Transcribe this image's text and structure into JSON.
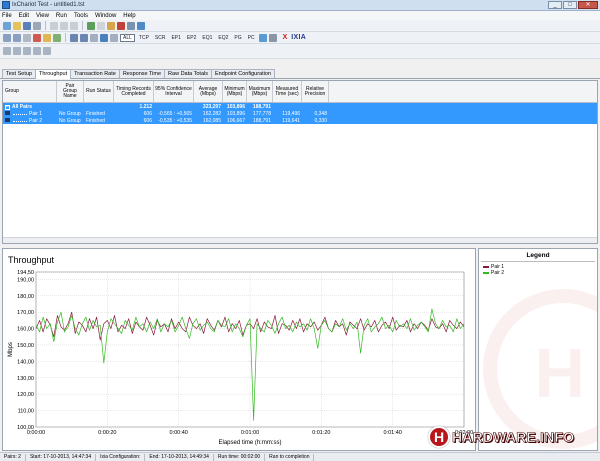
{
  "window": {
    "title": "IxChariot Test - untitled1.tst",
    "minimize": "_",
    "maximize": "□",
    "close": "✕"
  },
  "menu": [
    "File",
    "Edit",
    "View",
    "Run",
    "Tools",
    "Window",
    "Help"
  ],
  "toolbar": {
    "text_buttons": [
      "ALL",
      "TCP",
      "SCR",
      "EP1",
      "EP2",
      "EQ1",
      "EQ2",
      "PG",
      "PC"
    ],
    "brand": "IXIA",
    "brand_mark": "X"
  },
  "tabs": [
    "Test Setup",
    "Throughput",
    "Transaction Rate",
    "Response Time",
    "Raw Data Totals",
    "Endpoint Configuration"
  ],
  "active_tab": "Throughput",
  "grid": {
    "headers": [
      "Group",
      "Pair Group Name",
      "Run Status",
      "Timing Records Completed",
      "95% Confidence Interval",
      "Average (Mbps)",
      "Minimum (Mbps)",
      "Maximum (Mbps)",
      "Measured Time (sec)",
      "Relative Precision"
    ],
    "all_pairs": {
      "expander": "−",
      "label": "All Pairs",
      "records": "1.212",
      "average": "323,297",
      "minimum": "103,896",
      "maximum": "188,791"
    },
    "rows": [
      {
        "group": "Pair 1",
        "pair_group_name": "No Group",
        "run_status": "Finished",
        "records": "606",
        "ci": "-0,565 : +0,565",
        "average": "162,282",
        "minimum": "103,896",
        "maximum": "177,778",
        "measured_time": "119,496",
        "precision": "0,348"
      },
      {
        "group": "Pair 2",
        "pair_group_name": "No Group",
        "run_status": "Finished",
        "records": "606",
        "ci": "-0,535 : +0,535",
        "average": "162,085",
        "minimum": "106,667",
        "maximum": "188,791",
        "measured_time": "119,641",
        "precision": "0,330"
      }
    ]
  },
  "chart": {
    "title": "Throughput",
    "legend_title": "Legend"
  },
  "chart_data": {
    "type": "line",
    "title": "Throughput",
    "xlabel": "Elapsed time (h:mm:ss)",
    "ylabel": "Mbps",
    "xlim": [
      0,
      120
    ],
    "ylim": [
      100,
      194.5
    ],
    "x_ticks": [
      "0:00:00",
      "0:00:20",
      "0:00:40",
      "0:01:00",
      "0:01:20",
      "0:01:40",
      "0:02:00"
    ],
    "y_ticks": [
      "194,50",
      "190,00",
      "180,00",
      "170,00",
      "160,00",
      "150,00",
      "140,00",
      "130,00",
      "120,00",
      "110,00",
      "100,00"
    ],
    "grid": true,
    "legend_position": "side panel",
    "series": [
      {
        "name": "Pair 1",
        "color": "#8b1a3a",
        "values": [
          160,
          165,
          158,
          166,
          162,
          155,
          168,
          161,
          159,
          163,
          170,
          157,
          164,
          162,
          158,
          166,
          160,
          167,
          153,
          163,
          165,
          160,
          168,
          158,
          162,
          160,
          166,
          157,
          164,
          161,
          159,
          167,
          162,
          156,
          165,
          161,
          163,
          158,
          166,
          160,
          164,
          160,
          158,
          167,
          162,
          160,
          163,
          157,
          166,
          162,
          159,
          165,
          161,
          167,
          158,
          163,
          160,
          165,
          156,
          162,
          163,
          160,
          166,
          158,
          164,
          161,
          160,
          168,
          157,
          163,
          162,
          159,
          165,
          160,
          166,
          158,
          163,
          161,
          164,
          159,
          162,
          167,
          160,
          158,
          165,
          161,
          163,
          156,
          164,
          162,
          160,
          166,
          159,
          163,
          161,
          165,
          158,
          162,
          164,
          160,
          167,
          159,
          162,
          161,
          165,
          158,
          163,
          160,
          164,
          162,
          159,
          166,
          161,
          160,
          163,
          158,
          165,
          162,
          160,
          164,
          161
        ]
      },
      {
        "name": "Pair 2",
        "color": "#33bb22",
        "values": [
          162,
          158,
          167,
          160,
          163,
          152,
          164,
          170,
          158,
          161,
          168,
          160,
          156,
          163,
          167,
          159,
          165,
          161,
          162,
          139,
          158,
          166,
          163,
          160,
          157,
          165,
          162,
          159,
          167,
          161,
          163,
          158,
          164,
          160,
          166,
          158,
          163,
          161,
          165,
          158,
          162,
          167,
          160,
          154,
          163,
          166,
          159,
          162,
          164,
          160,
          158,
          165,
          162,
          161,
          166,
          158,
          163,
          160,
          155,
          162,
          166,
          104,
          163,
          160,
          158,
          165,
          162,
          157,
          163,
          167,
          160,
          162,
          158,
          164,
          161,
          163,
          159,
          166,
          160,
          148,
          162,
          165,
          160,
          158,
          163,
          161,
          166,
          159,
          163,
          160,
          164,
          145,
          162,
          166,
          158,
          161,
          163,
          167,
          160,
          162,
          158,
          165,
          161,
          163,
          160,
          166,
          159,
          162,
          164,
          161,
          158,
          172,
          163,
          160,
          165,
          161,
          162,
          158,
          166,
          160,
          163
        ]
      }
    ]
  },
  "watermark_logo": "HARDWARE.INFO",
  "status": {
    "pairs": "Pairs: 2",
    "start": "Start: 17-10-2013, 14:47:34",
    "ixia_config": "Ixia Configuration:",
    "end": "End: 17-10-2013, 14:49:34",
    "run_time": "Run time: 00:02:00",
    "completion": "Ran to completion"
  },
  "colors": {
    "selection": "#3399ff",
    "pair1": "#8b1a3a",
    "pair2": "#33bb22"
  }
}
